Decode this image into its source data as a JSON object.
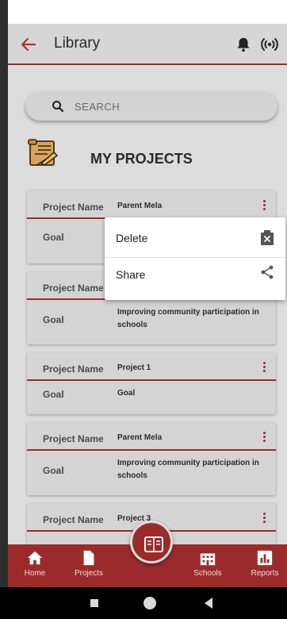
{
  "header": {
    "title": "Library",
    "back_icon": "arrow-left-icon",
    "notification_icon": "bell-icon",
    "broadcast_icon": "signal-icon"
  },
  "search": {
    "placeholder": "SEARCH"
  },
  "section": {
    "title": "MY PROJECTS",
    "icon": "project-scroll-icon"
  },
  "cards": [
    {
      "name_label": "Project Name",
      "name_value": "Parent Mela",
      "goal_label": "Goal",
      "goal_value": ""
    },
    {
      "name_label": "Project Name",
      "name_value": "",
      "goal_label": "Goal",
      "goal_value": "Improving community participation in schools"
    },
    {
      "name_label": "Project Name",
      "name_value": "Project 1",
      "goal_label": "Goal",
      "goal_value": "Goal"
    },
    {
      "name_label": "Project Name",
      "name_value": "Parent Mela",
      "goal_label": "Goal",
      "goal_value": "Improving community participation in schools"
    },
    {
      "name_label": "Project Name",
      "name_value": "Project 3",
      "goal_label": "",
      "goal_value": ""
    }
  ],
  "context_menu": [
    {
      "label": "Delete",
      "icon": "delete-box-icon"
    },
    {
      "label": "Share",
      "icon": "share-icon"
    }
  ],
  "bottom_nav": [
    {
      "label": "Home",
      "icon": "home-icon"
    },
    {
      "label": "Projects",
      "icon": "document-icon"
    },
    {
      "label": "Schools",
      "icon": "building-icon"
    },
    {
      "label": "Reports",
      "icon": "bar-chart-icon"
    }
  ],
  "fab": {
    "icon": "library-book-icon"
  },
  "colors": {
    "accent": "#9b2b2b",
    "background": "#dcdcdc",
    "card": "#d4d4d4"
  }
}
